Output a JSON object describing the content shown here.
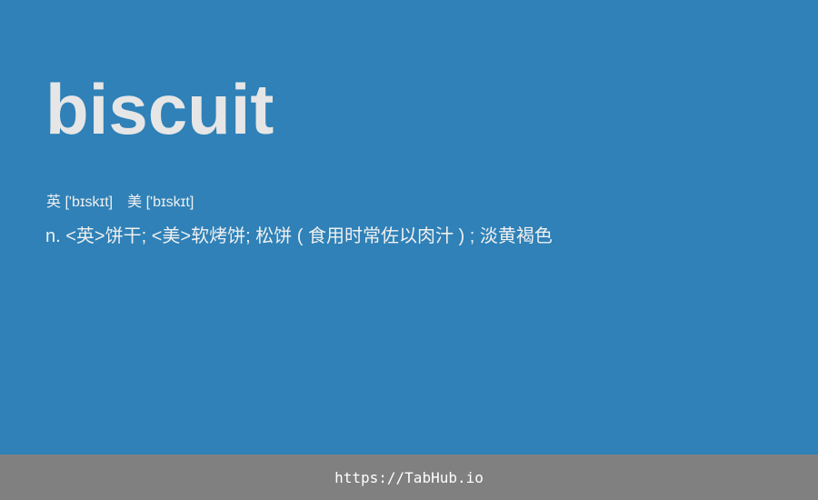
{
  "card": {
    "background": "#2f81b7",
    "word": "biscuit",
    "phonetics": {
      "uk": "英 ['bɪskɪt]",
      "us": "美 ['bɪskɪt]"
    },
    "definition": "n. <英>饼干; <美>软烤饼; 松饼 ( 食用时常佐以肉汁 ) ; 淡黄褐色"
  },
  "footer": {
    "background": "#808080",
    "link": "https://TabHub.io"
  }
}
